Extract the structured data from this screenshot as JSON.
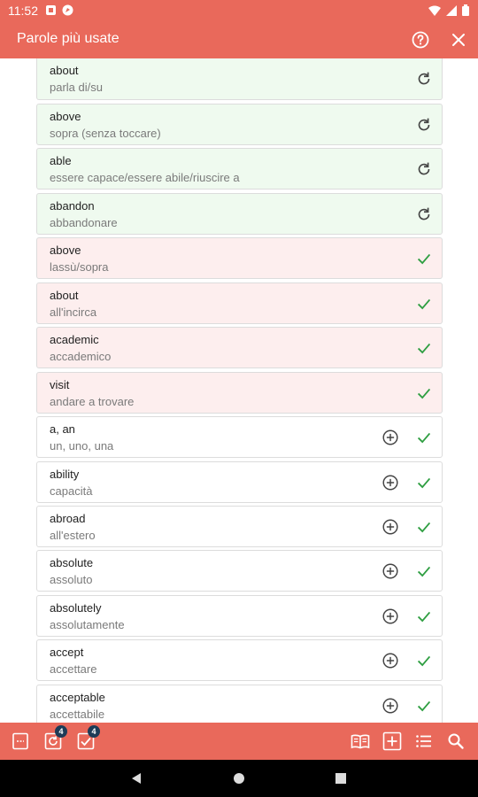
{
  "status": {
    "time": "11:52"
  },
  "header": {
    "title": "Parole più usate"
  },
  "colors": {
    "accent": "#e9695b",
    "learned_bg": "#effaef",
    "wrong_bg": "#fdeeee",
    "check": "#2e9e41",
    "badge": "#1d3b57"
  },
  "list": {
    "items": [
      {
        "word": "about",
        "translation": "parla di/su",
        "state": "green",
        "icon": "refresh-icon"
      },
      {
        "word": "above",
        "translation": "sopra (senza toccare)",
        "state": "green",
        "icon": "refresh-icon"
      },
      {
        "word": "able",
        "translation": "essere capace/essere abile/riuscire a",
        "state": "green",
        "icon": "refresh-icon"
      },
      {
        "word": "abandon",
        "translation": "abbandonare",
        "state": "green",
        "icon": "refresh-icon"
      },
      {
        "word": "above",
        "translation": "lassù/sopra",
        "state": "red",
        "icon": "check-icon"
      },
      {
        "word": "about",
        "translation": "all'incirca",
        "state": "red",
        "icon": "check-icon"
      },
      {
        "word": "academic",
        "translation": "accademico",
        "state": "red",
        "icon": "check-icon"
      },
      {
        "word": "visit",
        "translation": "andare a trovare",
        "state": "red",
        "icon": "check-icon"
      },
      {
        "word": "a, an",
        "translation": "un, uno, una",
        "state": "white",
        "icon": "check-icon"
      },
      {
        "word": "ability",
        "translation": "capacità",
        "state": "white",
        "icon": "check-icon"
      },
      {
        "word": "abroad",
        "translation": "all'estero",
        "state": "white",
        "icon": "check-icon"
      },
      {
        "word": "absolute",
        "translation": "assoluto",
        "state": "white",
        "icon": "check-icon"
      },
      {
        "word": "absolutely",
        "translation": "assolutamente",
        "state": "white",
        "icon": "check-icon"
      },
      {
        "word": "accept",
        "translation": "accettare",
        "state": "white",
        "icon": "check-icon"
      },
      {
        "word": "acceptable",
        "translation": "accettabile",
        "state": "white",
        "icon": "check-icon"
      }
    ]
  },
  "bottom_bar": {
    "review_count": "4",
    "learned_count": "4"
  }
}
